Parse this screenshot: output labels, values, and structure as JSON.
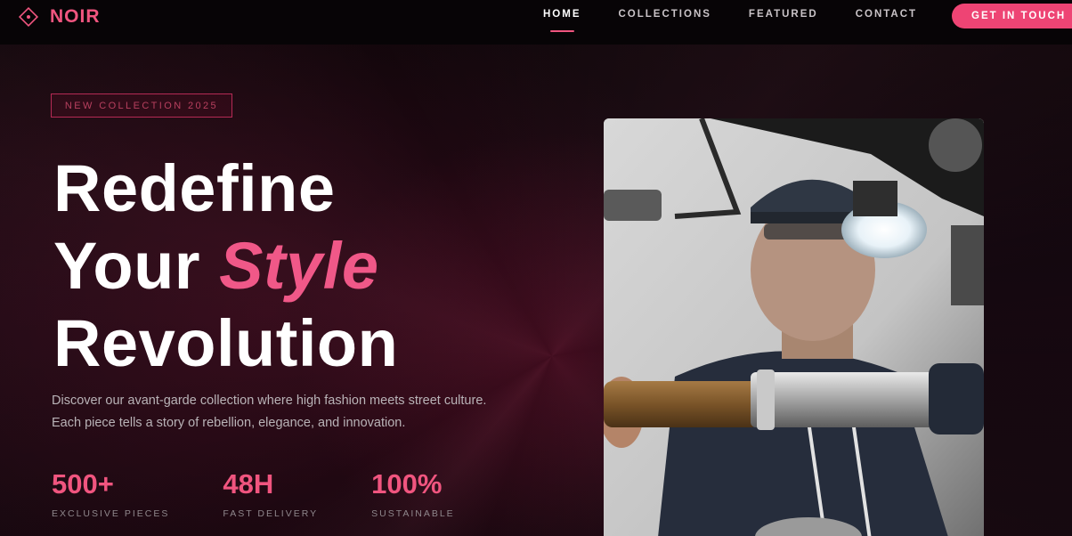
{
  "brand": {
    "name": "NOIR",
    "accent": "#f0557f"
  },
  "nav": {
    "items": [
      {
        "label": "HOME",
        "active": true
      },
      {
        "label": "COLLECTIONS",
        "active": false
      },
      {
        "label": "FEATURED",
        "active": false
      },
      {
        "label": "CONTACT",
        "active": false
      }
    ],
    "cta_label": "GET IN TOUCH"
  },
  "hero": {
    "badge": "NEW COLLECTION 2025",
    "headline": {
      "line1": "Redefine",
      "line2_prefix": "Your",
      "line2_accent": "Style",
      "line3": "Revolution"
    },
    "description": "Discover our avant-garde collection where high fashion meets street culture. Each piece tells a story of rebellion, elegance, and innovation.",
    "stats": [
      {
        "value": "500+",
        "label": "EXCLUSIVE PIECES"
      },
      {
        "value": "48H",
        "label": "FAST DELIVERY"
      },
      {
        "value": "100%",
        "label": "SUSTAINABLE"
      }
    ],
    "image_icon": "craftsman-photo"
  }
}
